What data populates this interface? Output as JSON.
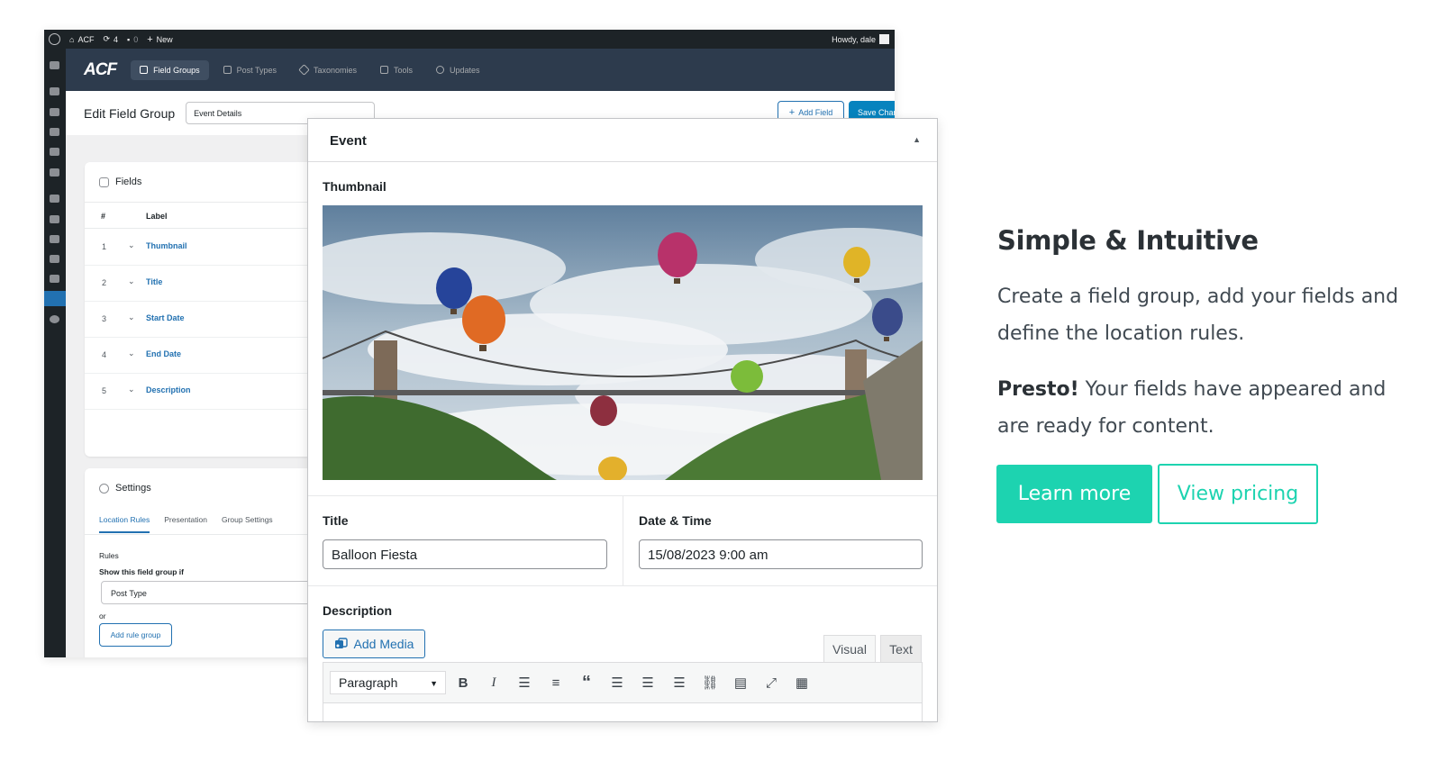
{
  "admin_bar": {
    "site": "ACF",
    "updates_count": "4",
    "comments_count": "0",
    "new_label": "New",
    "howdy": "Howdy, dale"
  },
  "acf_nav": {
    "logo": "ACF",
    "tabs": [
      {
        "label": "Field Groups",
        "icon": "grid-icon",
        "active": true
      },
      {
        "label": "Post Types",
        "icon": "document-icon",
        "active": false
      },
      {
        "label": "Taxonomies",
        "icon": "tag-icon",
        "active": false
      },
      {
        "label": "Tools",
        "icon": "tools-icon",
        "active": false
      },
      {
        "label": "Updates",
        "icon": "updates-icon",
        "active": false
      }
    ]
  },
  "edit_group": {
    "title": "Edit Field Group",
    "group_name": "Event Details",
    "add_field_label": "Add Field",
    "save_label": "Save Changes"
  },
  "fields_panel": {
    "title": "Fields",
    "col_num": "#",
    "col_label": "Label",
    "rows": [
      {
        "num": "1",
        "label": "Thumbnail"
      },
      {
        "num": "2",
        "label": "Title"
      },
      {
        "num": "3",
        "label": "Start Date"
      },
      {
        "num": "4",
        "label": "End Date"
      },
      {
        "num": "5",
        "label": "Description"
      }
    ]
  },
  "settings_panel": {
    "title": "Settings",
    "tabs": [
      "Location Rules",
      "Presentation",
      "Group Settings"
    ],
    "rules_label": "Rules",
    "show_if_label": "Show this field group if",
    "post_type_value": "Post Type",
    "or_label": "or",
    "add_rule_group_label": "Add rule group"
  },
  "event_box": {
    "title": "Event",
    "thumbnail_label": "Thumbnail",
    "title_label": "Title",
    "title_value": "Balloon Fiesta",
    "datetime_label": "Date & Time",
    "datetime_value": "15/08/2023 9:00 am",
    "description_label": "Description",
    "add_media_label": "Add Media",
    "tab_visual": "Visual",
    "tab_text": "Text",
    "format_value": "Paragraph"
  },
  "marketing": {
    "heading": "Simple & Intuitive",
    "para1": "Create a field group, add your fields and define the location rules.",
    "para2_bold": "Presto!",
    "para2_rest": " Your fields have appeared and are ready for content.",
    "learn_more": "Learn more",
    "view_pricing": "View pricing",
    "accent_color": "#1dd3b0"
  }
}
